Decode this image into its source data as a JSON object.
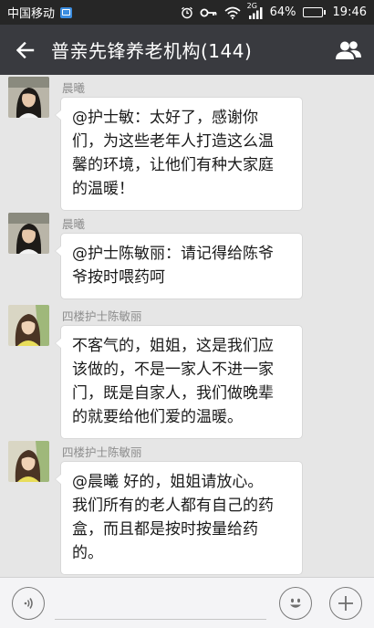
{
  "status_bar": {
    "carrier": "中国移动",
    "network": "2G",
    "battery_percent": "64%",
    "battery_level": 0.64,
    "time": "19:46",
    "icons": [
      "photo-icon",
      "alarm-icon",
      "key-icon",
      "wifi-icon",
      "signal-icon",
      "battery-icon"
    ]
  },
  "header": {
    "title": "普亲先锋养老机构(144)",
    "back_icon": "arrow-left-icon",
    "group_icon": "group-members-icon"
  },
  "messages": [
    {
      "sender": "晨曦",
      "text": "@护士敏：太好了，感谢你\n们，为这些老年人打造这么温\n馨的环境，让他们有种大家庭\n的温暖！"
    },
    {
      "sender": "晨曦",
      "text": "@护士陈敏丽：请记得给陈爷\n爷按时喂药呵"
    },
    {
      "sender": "四楼护士陈敏丽",
      "text": "不客气的，姐姐，这是我们应\n该做的，不是一家人不进一家\n门，既是自家人，我们做晚辈\n的就要给他们爱的温暖。"
    },
    {
      "sender": "四楼护士陈敏丽",
      "text": "@晨曦 好的，姐姐请放心。\n我们所有的老人都有自己的药\n盒，而且都是按时按量给药\n的。"
    }
  ],
  "input_bar": {
    "voice_icon": "voice-icon",
    "text_value": "",
    "emoji_icon": "emoji-icon",
    "plus_icon": "plus-icon"
  },
  "colors": {
    "status_bar_bg": "#262626",
    "title_bar_bg": "#393a3f",
    "chat_bg": "#e6e6e6",
    "bubble_bg": "#ffffff"
  }
}
